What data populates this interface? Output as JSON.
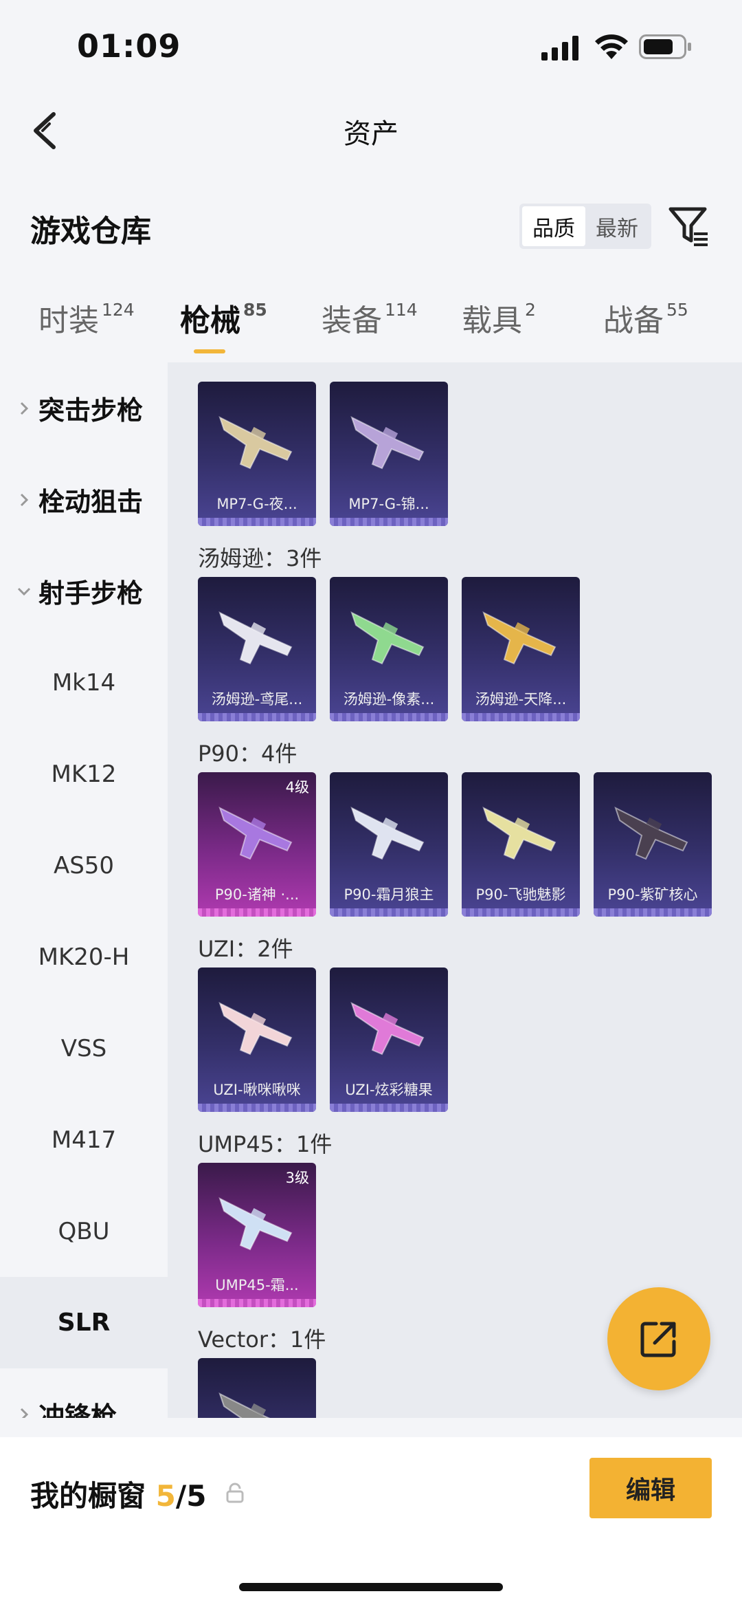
{
  "status_bar": {
    "time": "01:09"
  },
  "nav": {
    "title": "资产"
  },
  "header": {
    "title": "游戏仓库",
    "sort_options": [
      "品质",
      "最新"
    ],
    "active_sort": "品质"
  },
  "tabs": [
    {
      "label": "时装",
      "count": "124"
    },
    {
      "label": "枪械",
      "count": "85",
      "active": true
    },
    {
      "label": "装备",
      "count": "114"
    },
    {
      "label": "载具",
      "count": "2"
    },
    {
      "label": "战备",
      "count": "55"
    }
  ],
  "sidebar": {
    "categories": [
      "突击步枪",
      "栓动狙击",
      "射手步枪",
      "冲锋枪"
    ],
    "subcategories": [
      "Mk14",
      "MK12",
      "AS50",
      "MK20-H",
      "VSS",
      "M417",
      "QBU",
      "SLR"
    ],
    "active_sub": "SLR"
  },
  "groups": [
    {
      "label": "",
      "items": [
        {
          "name": "MP7-G-夜...",
          "tier": "",
          "color": "purple",
          "gun_color": "#d9c9a0"
        },
        {
          "name": "MP7-G-锦...",
          "tier": "",
          "color": "purple",
          "gun_color": "#b7a3d8"
        }
      ]
    },
    {
      "label": "汤姆逊：3件",
      "items": [
        {
          "name": "汤姆逊-鸢尾...",
          "tier": "",
          "color": "purple",
          "gun_color": "#e5e5ee"
        },
        {
          "name": "汤姆逊-像素...",
          "tier": "",
          "color": "purple",
          "gun_color": "#8fd98f"
        },
        {
          "name": "汤姆逊-天降...",
          "tier": "",
          "color": "purple",
          "gun_color": "#e5b54a"
        }
      ]
    },
    {
      "label": "P90：4件",
      "items": [
        {
          "name": "P90-诸神 ·...",
          "tier": "4级",
          "color": "pink",
          "gun_color": "#a878e0"
        },
        {
          "name": "P90-霜月狼主",
          "tier": "",
          "color": "purple",
          "gun_color": "#dfe3f0"
        },
        {
          "name": "P90-飞驰魅影",
          "tier": "",
          "color": "purple",
          "gun_color": "#e6e0a0"
        },
        {
          "name": "P90-紫矿核心",
          "tier": "",
          "color": "purple",
          "gun_color": "#4a4050"
        }
      ]
    },
    {
      "label": "UZI：2件",
      "items": [
        {
          "name": "UZI-啾咪啾咪",
          "tier": "",
          "color": "purple",
          "gun_color": "#f2d5d8"
        },
        {
          "name": "UZI-炫彩糖果",
          "tier": "",
          "color": "purple",
          "gun_color": "#e07ad8"
        }
      ]
    },
    {
      "label": "UMP45：1件",
      "items": [
        {
          "name": "UMP45-霜...",
          "tier": "3级",
          "color": "pink",
          "gun_color": "#cfe0f4"
        }
      ]
    },
    {
      "label": "Vector：1件",
      "items": [
        {
          "name": "",
          "tier": "",
          "color": "purple",
          "gun_color": "#888"
        }
      ]
    }
  ],
  "bottom_bar": {
    "showcase_label": "我的橱窗",
    "showcase_used": "5",
    "showcase_total": "/5",
    "edit_label": "编辑"
  },
  "colors": {
    "accent": "#f3b233",
    "card_purple": "#34306a",
    "card_pink": "#7b2a88"
  }
}
